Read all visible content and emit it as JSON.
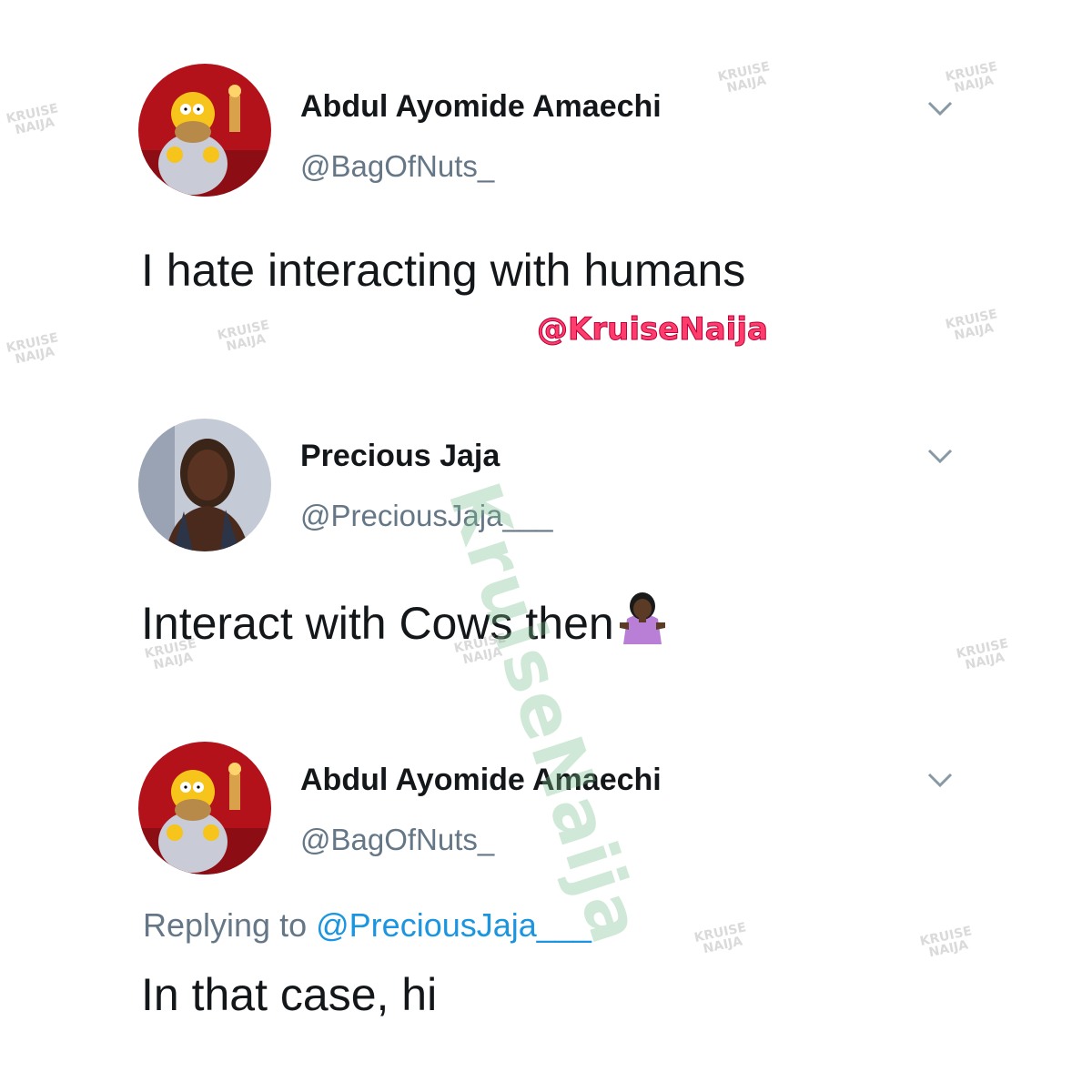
{
  "tweets": [
    {
      "name": "Abdul Ayomide Amaechi",
      "handle": "@BagOfNuts_",
      "text": "I hate interacting with humans",
      "avatar_icon": "homer-avatar-icon"
    },
    {
      "name": "Precious Jaja",
      "handle": "@PreciousJaja___",
      "text": "Interact with Cows then",
      "emoji_icon": "person-shrugging-emoji-icon",
      "avatar_icon": "woman-selfie-avatar-icon"
    },
    {
      "name": "Abdul Ayomide Amaechi",
      "handle": "@BagOfNuts_",
      "replying_prefix": "Replying to",
      "replying_to": "@PreciousJaja___",
      "text": "In that case, hi",
      "avatar_icon": "homer-avatar-icon"
    }
  ],
  "overlay_tag": "@KruiseNaija",
  "watermark": {
    "line1": "KRUISE",
    "line2": "NAIJA",
    "big": "KruiseNaija"
  },
  "colors": {
    "name": "#14171a",
    "handle": "#657786",
    "mention": "#1b95e0",
    "tag": "#ff3d6c"
  }
}
